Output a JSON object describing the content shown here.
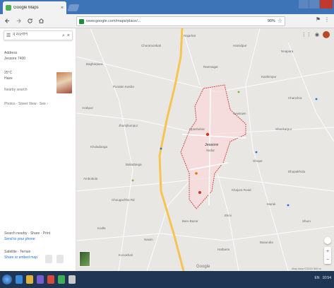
{
  "browser": {
    "tab_title": "Google Maps",
    "tab_close": "×",
    "url": "www.google.com/maps/place/...",
    "zoom": "90%",
    "nav": {
      "back": "←",
      "forward": "→",
      "reload": "⟳",
      "home": "⌂"
    }
  },
  "panel": {
    "search_value": "ব নওগাঁপ",
    "address_label": "Address",
    "address_value": "Jessore 7400",
    "weather_label": "25°C",
    "weather_value": "Haze",
    "nearby": "Nearby search",
    "photos_text": "Photos · Street View · See ›",
    "footer_1": "Search nearby · Share · Print",
    "footer_1_link": "Send to your phone",
    "footer_2": "Satellite · Terrain",
    "footer_2_link": "Share or embed map"
  },
  "map": {
    "place_label": "Jessore",
    "place_sub": "Sadar",
    "labels": [
      "Rajarhat",
      "Churamonkati",
      "Hamidpur",
      "Noapara",
      "Bagharpara",
      "Ramnagar",
      "Kashimpur",
      "Puratan Kasba",
      "Chanchra",
      "Arabpur",
      "Newtown",
      "Jhumjhumpur",
      "Shankarpur",
      "Upashahar",
      "Kholadanga",
      "Ghope",
      "Baliadanga",
      "Dhopakhola",
      "Ambottola",
      "Khajura Road",
      "Chougachha Rd",
      "Murali",
      "Baro Bazar",
      "Ekmi",
      "Shuro",
      "Kodla",
      "Nasim",
      "Basundia",
      "Hatbaria",
      "Konokhali"
    ],
    "google_logo": "Google",
    "attrib": "Map data ©2019   500 m"
  },
  "taskbar": {
    "tray_lang": "EN",
    "clock": "10:54"
  }
}
